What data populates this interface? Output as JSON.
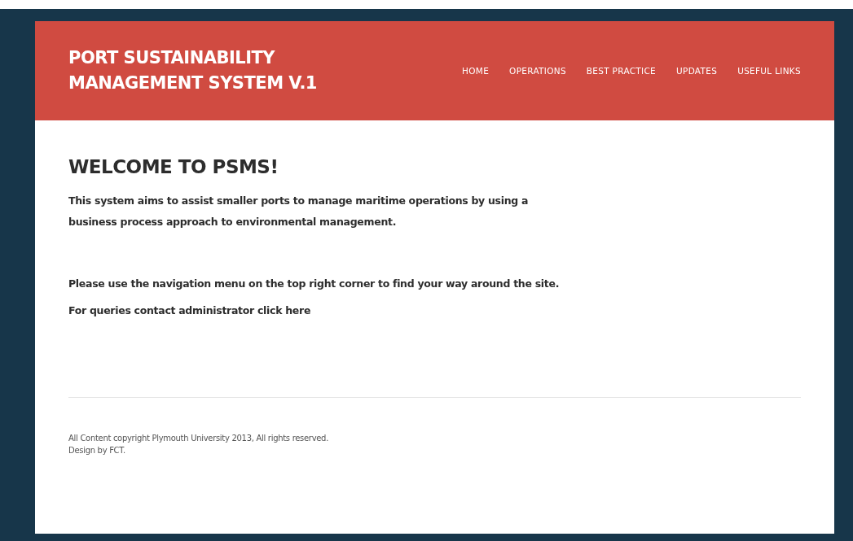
{
  "header": {
    "site_title_lines": [
      "PORT SUSTAINABILITY",
      "MANAGEMENT SYSTEM V.1"
    ],
    "nav": [
      {
        "label": "HOME"
      },
      {
        "label": "OPERATIONS"
      },
      {
        "label": "BEST PRACTICE"
      },
      {
        "label": "UPDATES"
      },
      {
        "label": "USEFUL LINKS"
      }
    ]
  },
  "main": {
    "heading": "WELCOME TO PSMS!",
    "intro": "This system aims to assist smaller ports to manage maritime operations by using a business process approach to environmental management.",
    "navigation_hint": "Please use the navigation menu on the top right corner to find your way around the site.",
    "contact": {
      "text": "For queries contact administrator",
      "link": "click here"
    }
  },
  "footer": {
    "lines": [
      "All Content copyright Plymouth University 2013, All rights reserved.",
      "Design by FCT."
    ]
  }
}
